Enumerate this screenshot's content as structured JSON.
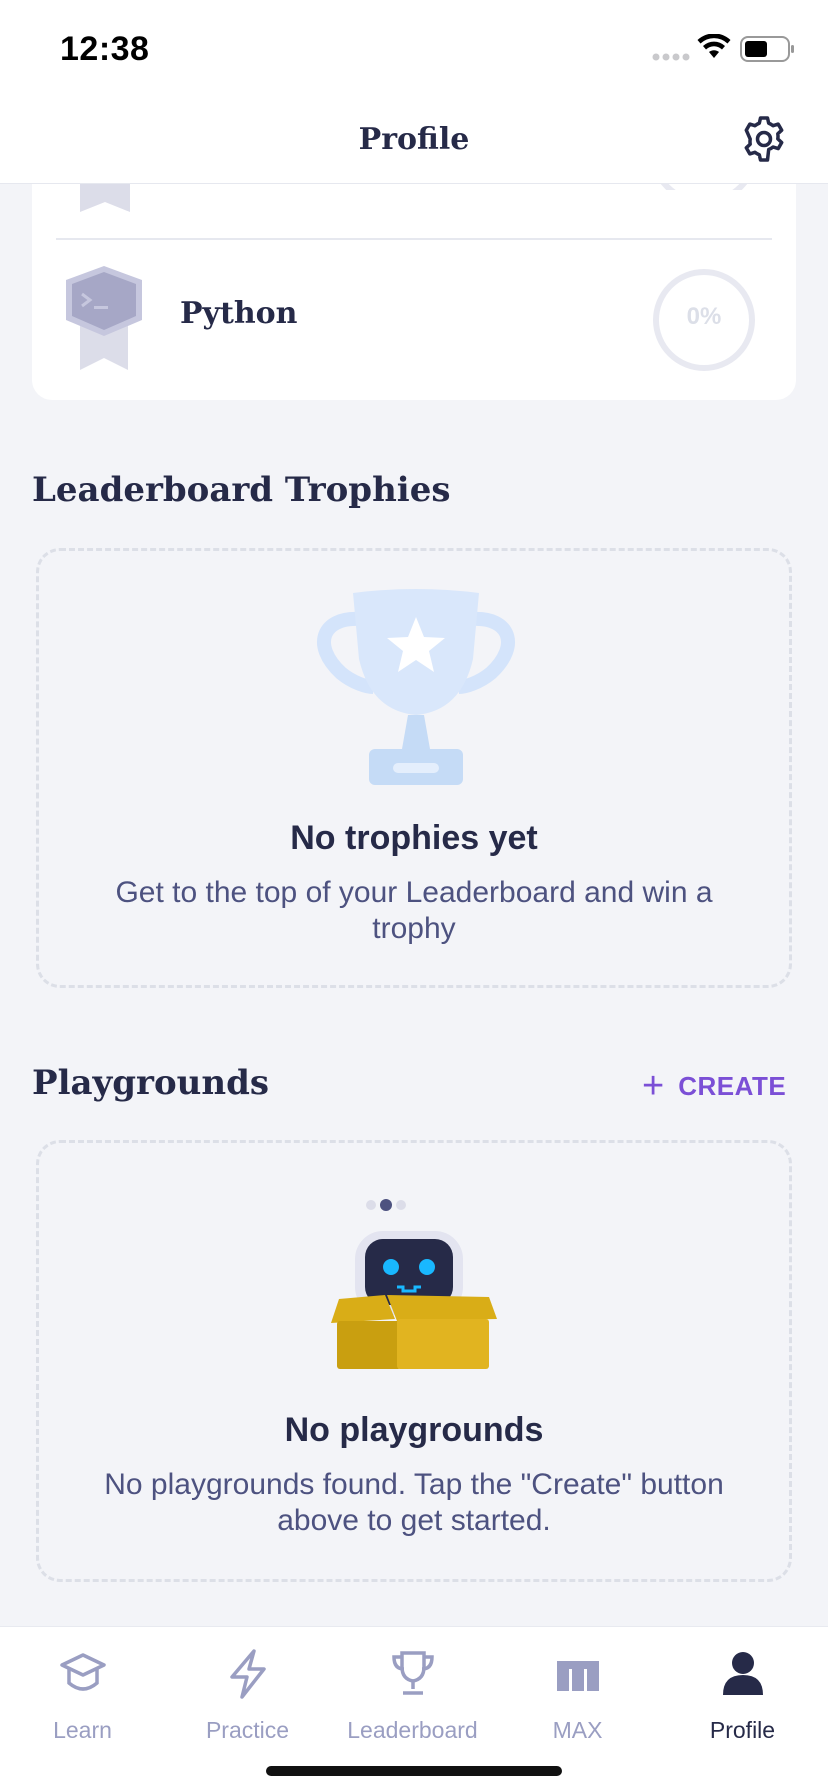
{
  "status_bar": {
    "time": "12:38"
  },
  "header": {
    "title": "Profile"
  },
  "courses": {
    "items": [
      {
        "name": "Python",
        "progress": "0%"
      }
    ]
  },
  "trophies": {
    "title": "Leaderboard Trophies",
    "empty_title": "No trophies yet",
    "empty_desc": "Get to the top of your Leaderboard and win a trophy"
  },
  "playgrounds": {
    "title": "Playgrounds",
    "create_label": "CREATE",
    "empty_title": "No playgrounds",
    "empty_desc": "No playgrounds found. Tap the \"Create\" button above to get started."
  },
  "tabs": [
    {
      "label": "Learn",
      "icon": "graduation-cap-icon"
    },
    {
      "label": "Practice",
      "icon": "lightning-icon"
    },
    {
      "label": "Leaderboard",
      "icon": "trophy-icon"
    },
    {
      "label": "MAX",
      "icon": "max-logo-icon"
    },
    {
      "label": "Profile",
      "icon": "user-icon",
      "active": true
    }
  ],
  "colors": {
    "accent": "#7b4fd6",
    "text": "#262a48",
    "muted": "#9a9ec2",
    "background": "#f3f4f8"
  }
}
